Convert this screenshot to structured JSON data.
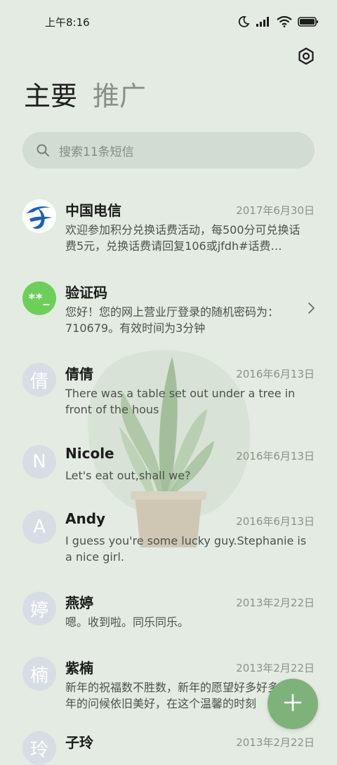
{
  "status_bar": {
    "time": "上午8:16",
    "icons": [
      "moon-icon",
      "signal-icon",
      "wifi-icon",
      "battery-icon"
    ]
  },
  "header": {
    "settings_icon": "settings-hexagon-icon",
    "tabs": [
      {
        "label": "主要",
        "active": true
      },
      {
        "label": "推广",
        "active": false
      }
    ]
  },
  "search": {
    "icon": "search-icon",
    "placeholder": "搜索11条短信"
  },
  "messages": [
    {
      "avatar": "china-telecom-logo",
      "avatar_text": "",
      "name": "中国电信",
      "date": "2017年6月30日",
      "preview": "欢迎参加积分兑换话费活动，每500分可兑换话费5元，兑换话费请回复106或jfdh#话费…"
    },
    {
      "avatar": "verification-code-icon",
      "avatar_text": "**_",
      "name": "验证码",
      "date": "",
      "preview": "您好！您的网上营业厅登录的随机密码为：710679。有效时间为3分钟",
      "has_chevron": true
    },
    {
      "avatar": "letter",
      "avatar_text": "倩",
      "name": "倩倩",
      "date": "2016年6月13日",
      "preview": "There was a table set out under a tree in front of the hous"
    },
    {
      "avatar": "letter",
      "avatar_text": "N",
      "name": "Nicole",
      "date": "2016年6月13日",
      "preview": "Let's eat out,shall we?"
    },
    {
      "avatar": "letter",
      "avatar_text": "A",
      "name": "Andy",
      "date": "2016年6月13日",
      "preview": "I guess you're some lucky guy.Stephanie is a nice girl."
    },
    {
      "avatar": "letter",
      "avatar_text": "婷",
      "name": "燕婷",
      "date": "2013年2月22日",
      "preview": "嗯。收到啦。同乐同乐。"
    },
    {
      "avatar": "letter",
      "avatar_text": "楠",
      "name": "紫楠",
      "date": "2013年2月22日",
      "preview": "新年的祝福数不胜数，新年的愿望好多好多，新年的问候依旧美好，在这个温馨的时刻"
    },
    {
      "avatar": "letter",
      "avatar_text": "玲",
      "name": "子玲",
      "date": "2013年2月22日",
      "preview": ""
    }
  ],
  "fab": {
    "icon": "plus-icon",
    "color": "#7fb27a"
  },
  "colors": {
    "background": "#e3ebe2",
    "search_bg": "#d3dcd2",
    "accent_green": "#6ccf5a",
    "telecom_blue": "#1b5fb8"
  }
}
